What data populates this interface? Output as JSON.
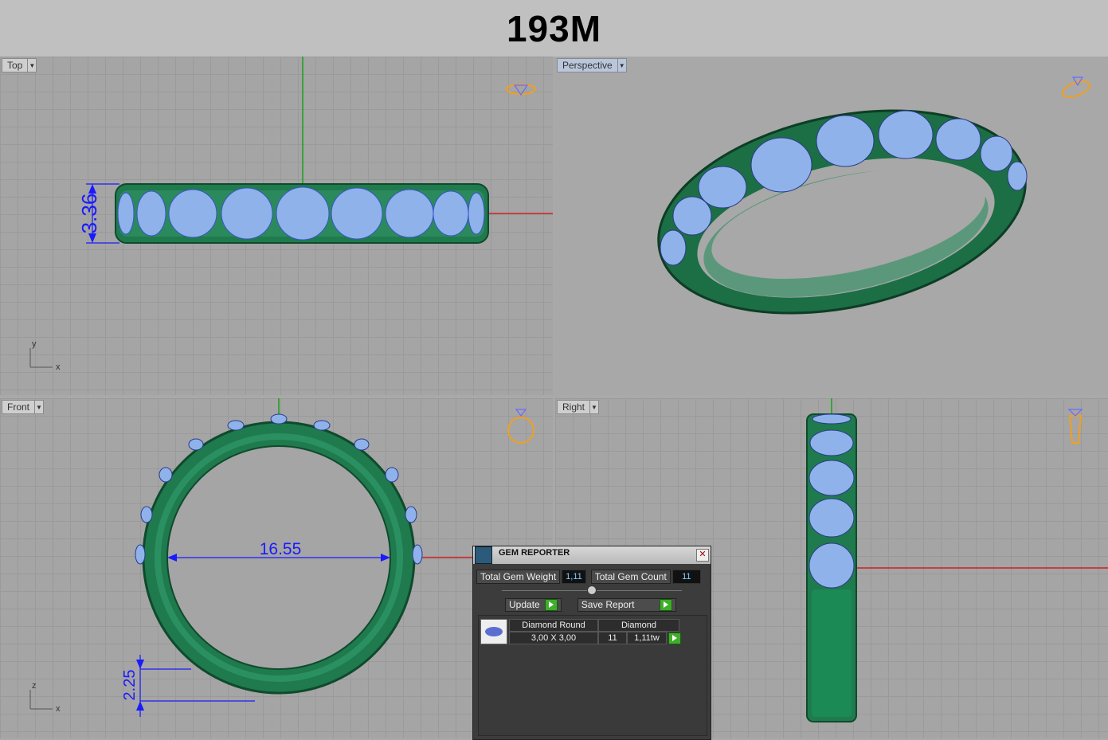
{
  "header": {
    "title": "193M"
  },
  "viewports": {
    "top": {
      "label": "Top",
      "dimension": "3.36",
      "axis_x": "x",
      "axis_y": "y"
    },
    "perspective": {
      "label": "Perspective"
    },
    "front": {
      "label": "Front",
      "dimension_diameter": "16.55",
      "dimension_thickness": "2.25",
      "axis_x": "x",
      "axis_y": "z"
    },
    "right": {
      "label": "Right"
    }
  },
  "gem_reporter": {
    "title": "GEM REPORTER",
    "total_weight_label": "Total Gem Weight",
    "total_weight_value": "1,11",
    "total_count_label": "Total Gem Count",
    "total_count_value": "11",
    "update_label": "Update",
    "save_report_label": "Save Report",
    "rows": [
      {
        "name": "Diamond Round",
        "material": "Diamond",
        "size": "3,00 X 3,00",
        "count": "11",
        "weight": "1,11tw"
      }
    ]
  },
  "colors": {
    "metal": "#1f7a4d",
    "gem": "#8fb2ea",
    "dimension": "#1a1aff",
    "axis_x": "#d02020",
    "axis_y": "#10a010",
    "icon": "#f0a020"
  }
}
